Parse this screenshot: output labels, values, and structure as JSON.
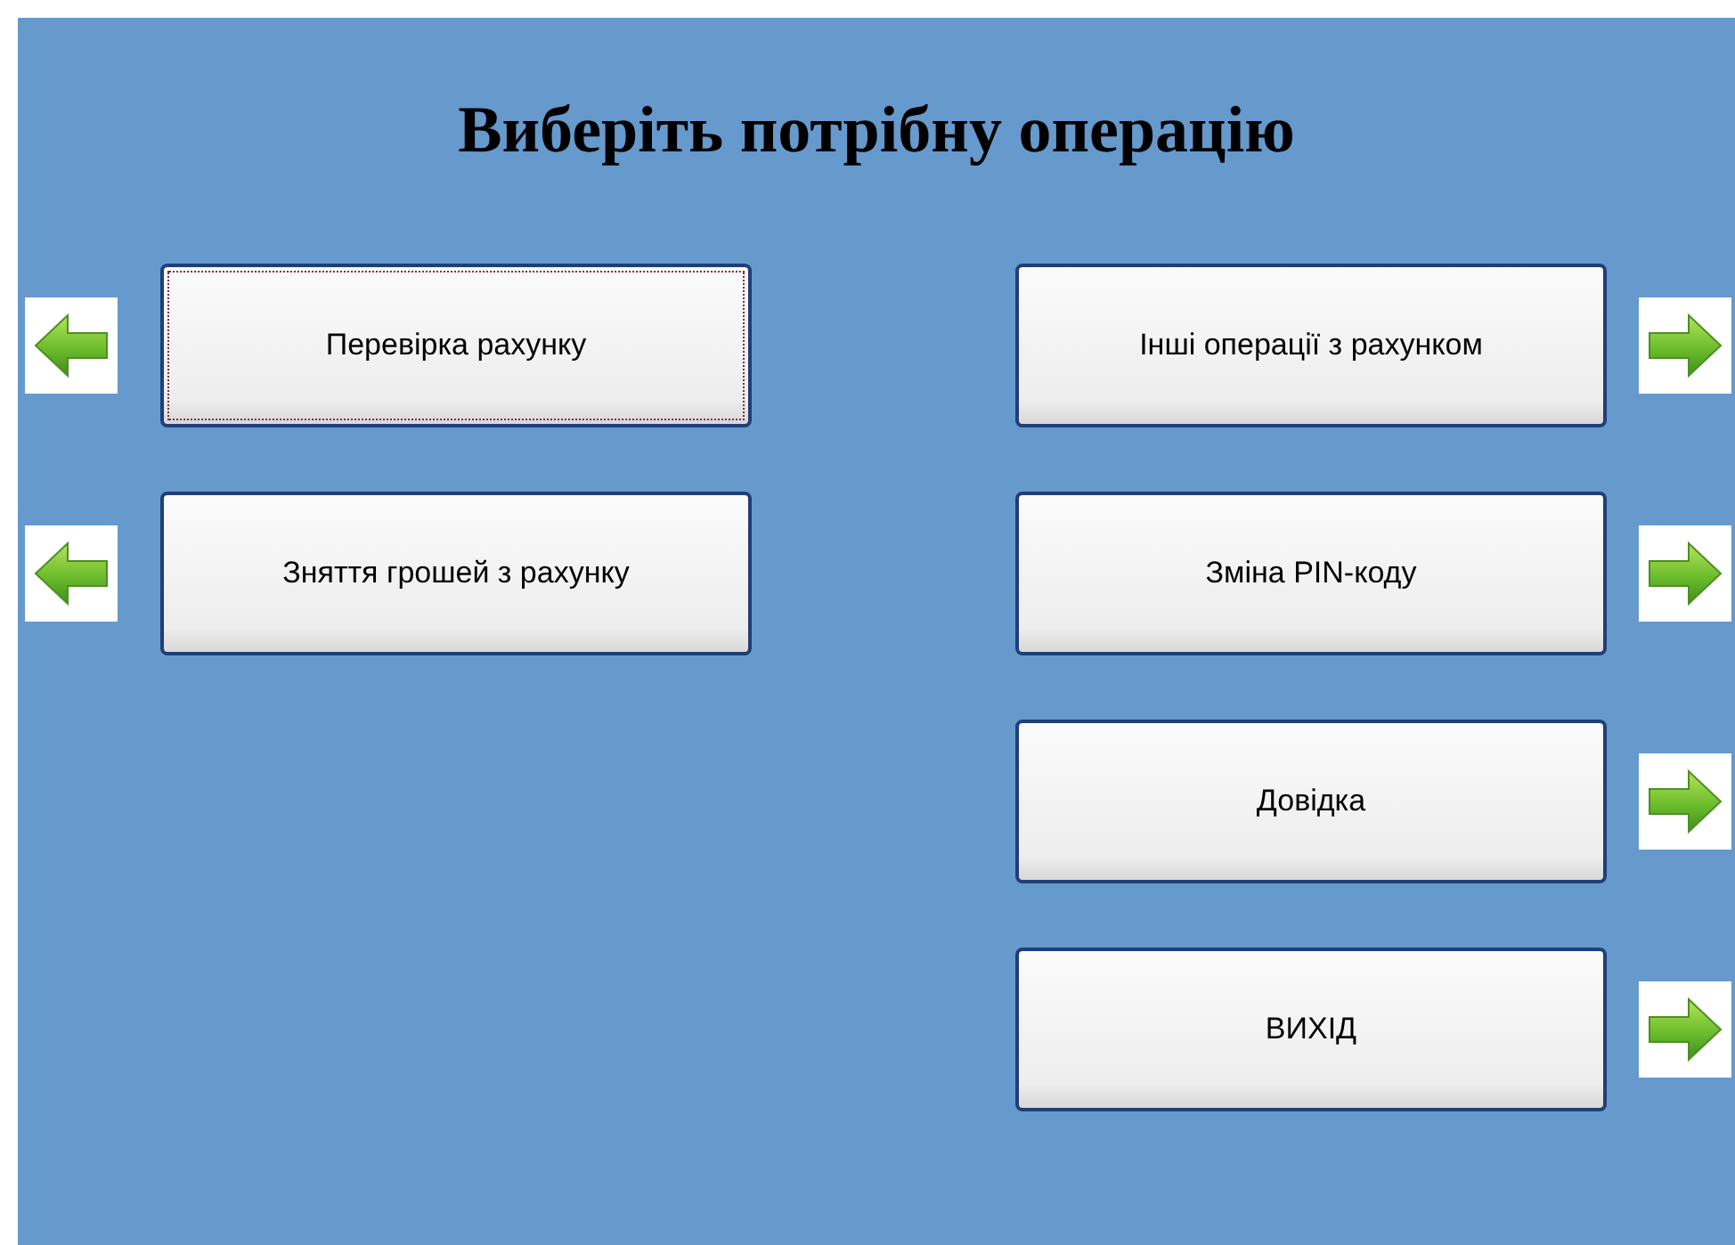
{
  "title": "Виберіть потрібну операцію",
  "left_options": [
    {
      "label": "Перевірка рахунку",
      "focused": true
    },
    {
      "label": "Зняття грошей  з рахунку",
      "focused": false
    }
  ],
  "right_options": [
    {
      "label": "Інші операції з рахунком",
      "focused": false
    },
    {
      "label": "Зміна PIN-коду",
      "focused": false
    },
    {
      "label": "Довідка",
      "focused": false
    },
    {
      "label": "ВИХІД",
      "focused": false
    }
  ]
}
